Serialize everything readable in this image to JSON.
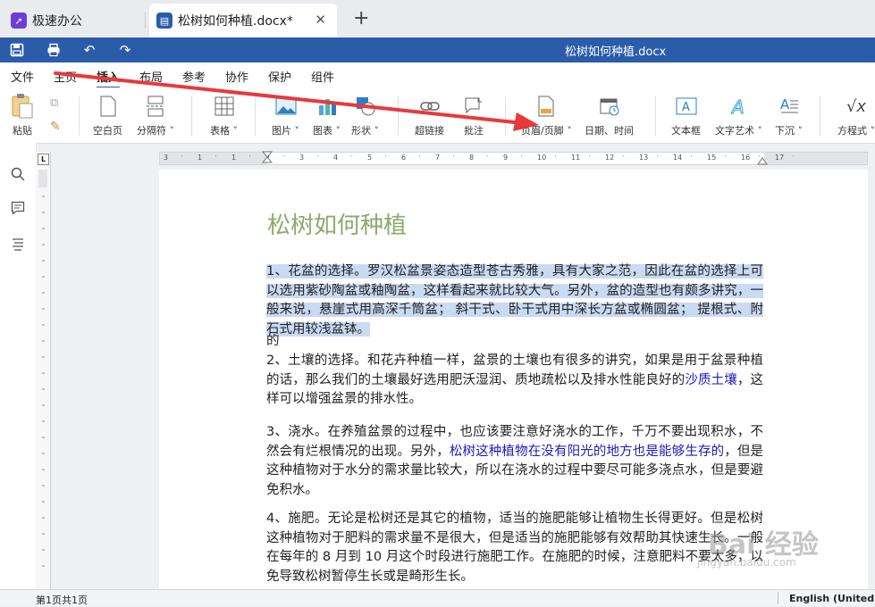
{
  "tabs": {
    "home_label": "极速办公",
    "doc_label": "松树如何种植.docx*",
    "close": "✕",
    "new_tab": "+"
  },
  "titlebar": {
    "title": "松树如何种植.docx"
  },
  "menu": [
    "文件",
    "主页",
    "插入",
    "布局",
    "参考",
    "协作",
    "保护",
    "组件"
  ],
  "menu_active": "插入",
  "ribbon": {
    "paste": "粘贴",
    "blank_page": "空白页",
    "separator": "分隔符",
    "table": "表格",
    "image": "图片",
    "chart": "图表",
    "shape": "形状",
    "hyperlink": "超链接",
    "comment": "批注",
    "header_footer": "页眉/页脚",
    "date_time": "日期、时间",
    "text_box": "文本框",
    "text_art": "文字艺术",
    "drop_cap": "下沉",
    "equation": "方程式"
  },
  "ruler_numbers": [
    "3",
    "1",
    "1",
    "2",
    "3",
    "4",
    "5",
    "6",
    "7",
    "8",
    "9",
    "10",
    "11",
    "12",
    "13",
    "14",
    "15",
    "16",
    "17"
  ],
  "document": {
    "title": "松树如何种植",
    "p1": "1、花盆的选择。罗汉松盆景姿态造型苍古秀雅，具有大家之范，因此在盆的选择上可以选用紫砂陶盆或釉陶盆，这样看起来就比较大气。另外，盆的造型也有颇多讲究，一般来说，悬崖式用高深千筒盆；  斜干式、卧干式用中深长方盆或椭圆盆；   提根式、附石式用较浅盆钵。",
    "p_de": "的",
    "p2_a": "2、土壤的选择。和花卉种植一样，盆景的土壤也有很多的讲究，如果是用于盆景种植的话，那么我们的土壤最好选用肥沃湿润、质地疏松以及排水性能良好的",
    "p2_link": "沙质土壤",
    "p2_b": "，这样可以增强盆景的排水性。",
    "p3_a": "3、浇水。在养殖盆景的过程中，也应该要注意好浇水的工作，千万不要出现积水，不然会有烂根情况的出现。另外，",
    "p3_link": "松树这种植物在没有阳光的地方也是能够生存的",
    "p3_b": "，但是这种植物对于水分的需求量比较大，所以在浇水的过程中要尽可能多浇点水，但是要避免积水。",
    "p4": "4、施肥。无论是松树还是其它的植物，适当的施肥能够让植物生长得更好。但是松树这种植物对于肥料的需求量不是很大，但是适当的施肥能够有效帮助其快速生长。一般在每年的 8 月到 10 月这个时段进行施肥工作。在施肥的时候，注意肥料不要太多，以免导致松树暂停生长或是畸形生长。"
  },
  "status": {
    "page": "第1页共1页",
    "language": "English (United Sta"
  },
  "watermark": {
    "text": "Bai 经验",
    "url": "jingyan.baidu.com"
  },
  "colors": {
    "accent": "#2a5caa",
    "title_green": "#8aab6c",
    "selection": "#c9daf3",
    "annotation_arrow": "#e8393b"
  }
}
